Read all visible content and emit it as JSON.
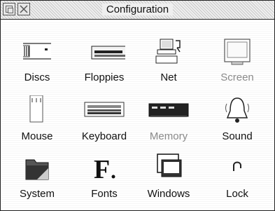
{
  "window": {
    "title": "Configuration"
  },
  "items": [
    {
      "label": "Discs",
      "icon": "discs-icon"
    },
    {
      "label": "Floppies",
      "icon": "floppies-icon"
    },
    {
      "label": "Net",
      "icon": "net-icon"
    },
    {
      "label": "Screen",
      "icon": "screen-icon"
    },
    {
      "label": "Mouse",
      "icon": "mouse-icon"
    },
    {
      "label": "Keyboard",
      "icon": "keyboard-icon"
    },
    {
      "label": "Memory",
      "icon": "memory-icon"
    },
    {
      "label": "Sound",
      "icon": "bell-icon"
    },
    {
      "label": "System",
      "icon": "folder-icon"
    },
    {
      "label": "Fonts",
      "icon": "font-icon"
    },
    {
      "label": "Windows",
      "icon": "windows-icon"
    },
    {
      "label": "Lock",
      "icon": "lock-icon"
    }
  ]
}
